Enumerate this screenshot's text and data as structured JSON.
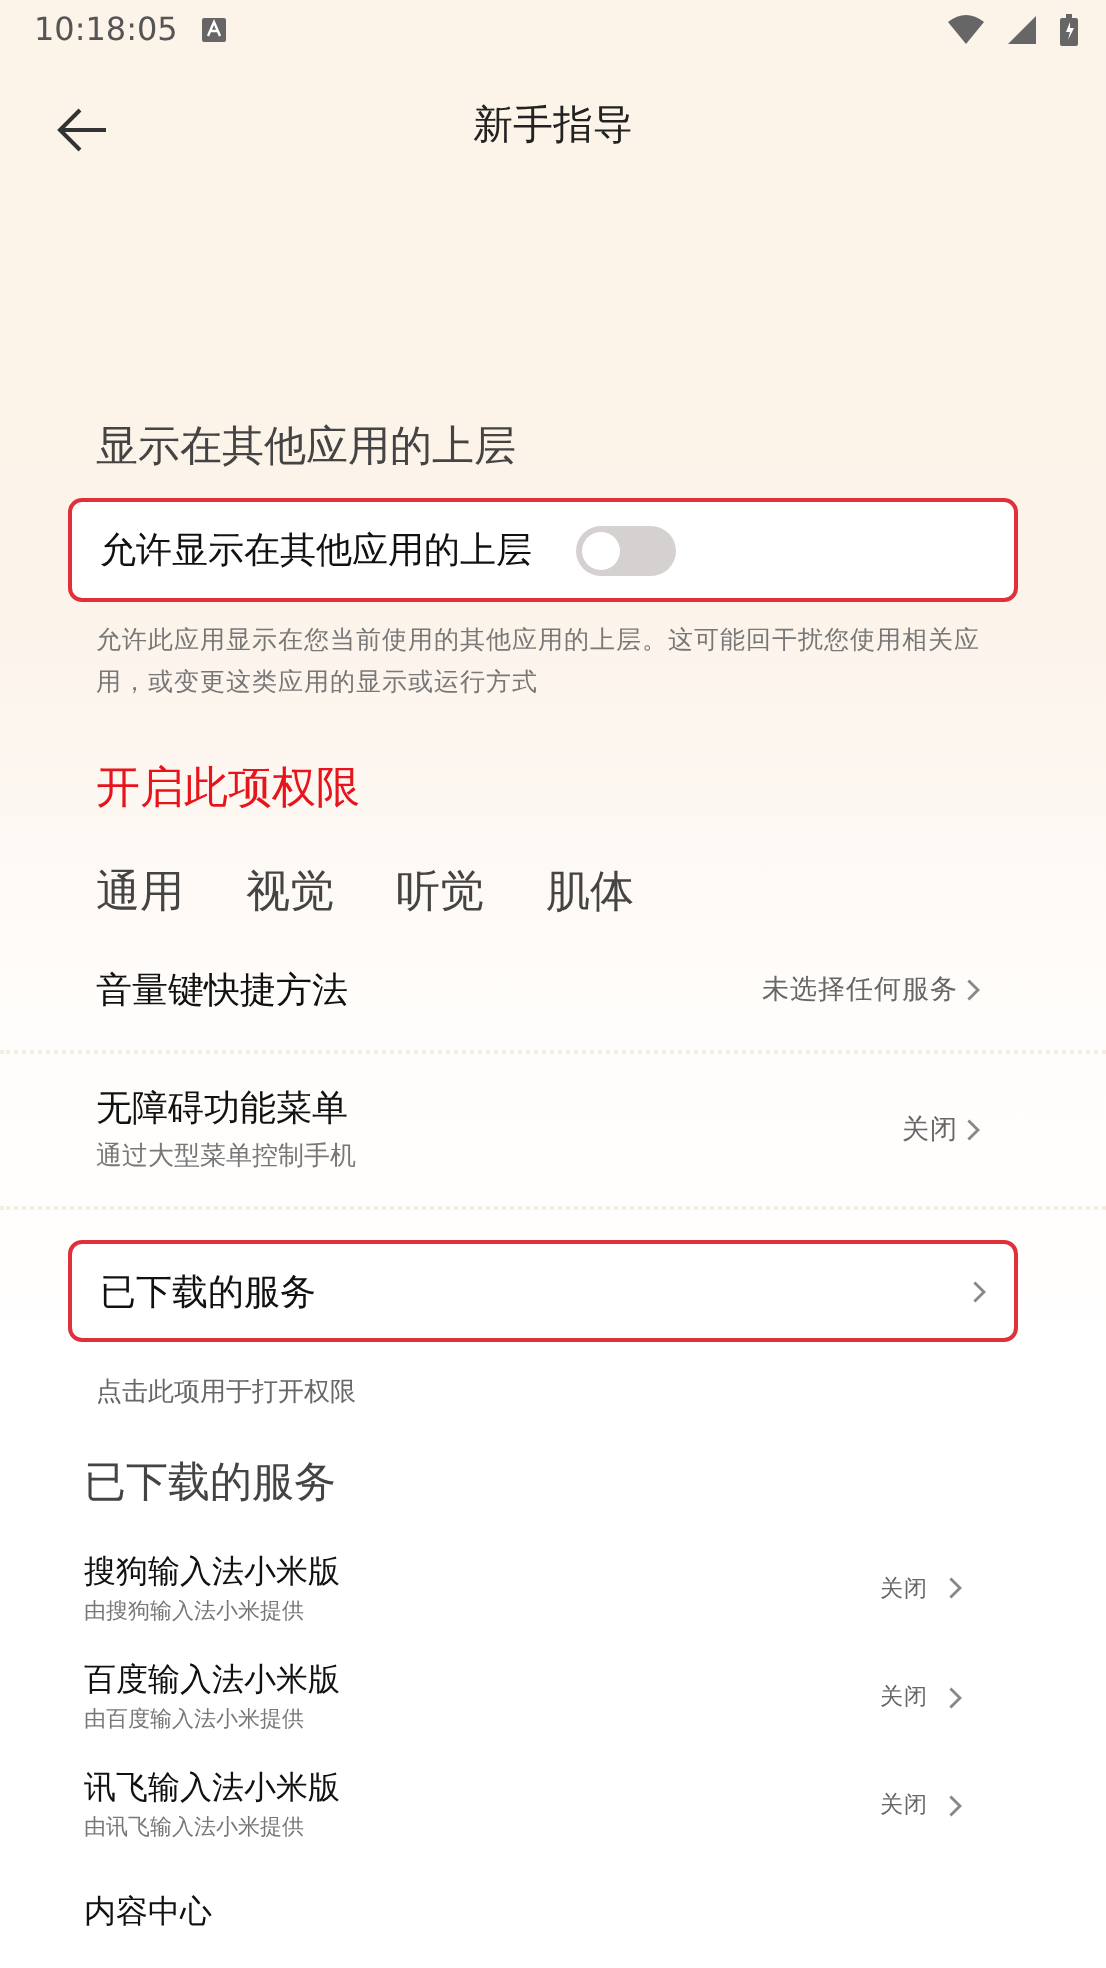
{
  "status_bar": {
    "time": "10:18:05"
  },
  "header": {
    "title": "新手指导"
  },
  "overlay_section": {
    "title": "显示在其他应用的上层",
    "toggle": {
      "label": "允许显示在其他应用的上层",
      "on": false
    },
    "description": "允许此应用显示在您当前使用的其他应用的上层。这可能回干扰您使用相关应用，或变更这类应用的显示或运行方式"
  },
  "prompt": "开启此项权限",
  "tabs": [
    {
      "label": "通用"
    },
    {
      "label": "视觉"
    },
    {
      "label": "听觉"
    },
    {
      "label": "肌体"
    }
  ],
  "settings": [
    {
      "title": "音量键快捷方法",
      "value": "未选择任何服务"
    },
    {
      "title": "无障碍功能菜单",
      "subtitle": "通过大型菜单控制手机",
      "value": "关闭"
    }
  ],
  "highlight_item": {
    "title": "已下载的服务",
    "hint": "点击此项用于打开权限"
  },
  "downloaded_services": {
    "title": "已下载的服务",
    "items": [
      {
        "title": "搜狗输入法小米版",
        "subtitle": "由搜狗输入法小米提供",
        "value": "关闭"
      },
      {
        "title": "百度输入法小米版",
        "subtitle": "由百度输入法小米提供",
        "value": "关闭"
      },
      {
        "title": "讯飞输入法小米版",
        "subtitle": "由讯飞输入法小米提供",
        "value": "关闭"
      },
      {
        "title": "内容中心"
      }
    ]
  }
}
